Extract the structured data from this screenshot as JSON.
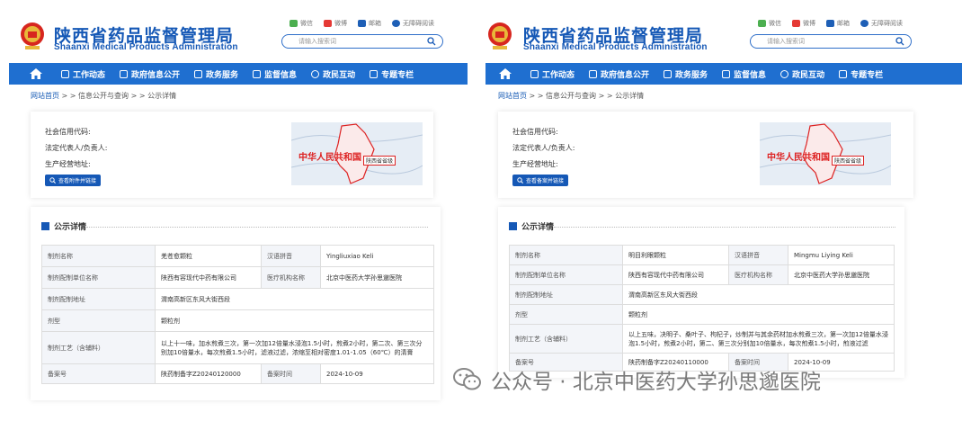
{
  "left": {
    "header": {
      "title_cn": "陕西省药品监督管理局",
      "title_en": "Shaanxi Medical Products Administration",
      "top_links": [
        "微信",
        "微博",
        "邮箱",
        "无障碍阅读"
      ],
      "search_placeholder": "请输入搜索词"
    },
    "nav": [
      "工作动态",
      "政府信息公开",
      "政务服务",
      "监督信息",
      "政民互动",
      "专题专栏"
    ],
    "breadcrumb": {
      "home": "网站首页",
      "rest": " > > 信息公开与查询 > > 公示详情"
    },
    "info_fields": [
      "社会信用代码:",
      "法定代表人/负责人:",
      "生产经营地址:"
    ],
    "report_button": "查看附件并链接"
  },
  "right": {
    "header": {
      "title_cn": "陕西省药品监督管理局",
      "title_en": "Shaanxi Medical Products Administration",
      "top_links": [
        "微信",
        "微博",
        "邮箱",
        "无障碍阅读"
      ],
      "search_placeholder": "请输入搜索词"
    },
    "nav": [
      "工作动态",
      "政府信息公开",
      "政务服务",
      "监督信息",
      "政民互动",
      "专题专栏"
    ],
    "breadcrumb": {
      "home": "网站首页",
      "rest": " > > 信息公开与查询 > > 公示详情"
    },
    "info_fields": [
      "社会信用代码:",
      "法定代表人/负责人:",
      "生产经营地址:"
    ],
    "report_button": "查看备案并链接"
  },
  "map": {
    "country_label": "中华人民共和国",
    "province_tag": "陕西省省级"
  },
  "section_title": "公示详情",
  "table_left": {
    "name_label": "制剂名称",
    "name": "羌苍愈颗粒",
    "pinyin_label": "汉语拼音",
    "pinyin": "Yingliuxiao Keli",
    "unit_label": "制剂配制单位名称",
    "unit": "陕西有容现代中药有限公司",
    "inst_label": "医疗机构名称",
    "inst": "北京中医药大学孙思邈医院",
    "addr_label": "制剂配制地址",
    "addr": "渭南高新区东风大街西段",
    "form_label": "剂型",
    "form": "颗粒剂",
    "process_label": "制剂工艺（含辅料）",
    "process": "以上十一味，加水煎煮三次，第一次加12倍量水浸泡1.5小时，煎煮2小时，第二次、第三次分别加10倍量水，每次煎煮1.5小时，滤液过滤，浓缩至相对密度1.01-1.05（60℃）的清膏",
    "record_label": "备案号",
    "record": "陕药制备字Z20240120000",
    "time_label": "备案时间",
    "time": "2024-10-09"
  },
  "table_right": {
    "name_label": "制剂名称",
    "name": "明目利眼颗粒",
    "pinyin_label": "汉语拼音",
    "pinyin": "Mingmu Liying Keli",
    "unit_label": "制剂配制单位名称",
    "unit": "陕西有容现代中药有限公司",
    "inst_label": "医疗机构名称",
    "inst": "北京中医药大学孙思邈医院",
    "addr_label": "制剂配制地址",
    "addr": "渭南高新区东风大街西段",
    "form_label": "剂型",
    "form": "颗粒剂",
    "process_label": "制剂工艺（含辅料）",
    "process": "以上五味，决明子、桑叶子、枸杞子，炒制并与其余药材加水煎煮三次，第一次加12倍量水浸泡1.5小时，煎煮2小时，第二、第三次分别加10倍量水，每次煎煮1.5小时，煎液过滤",
    "record_label": "备案号",
    "record": "陕药制备字Z20240110000",
    "time_label": "备案时间",
    "time": "2024-10-09"
  },
  "watermark": "公众号 · 北京中医药大学孙思邈医院"
}
